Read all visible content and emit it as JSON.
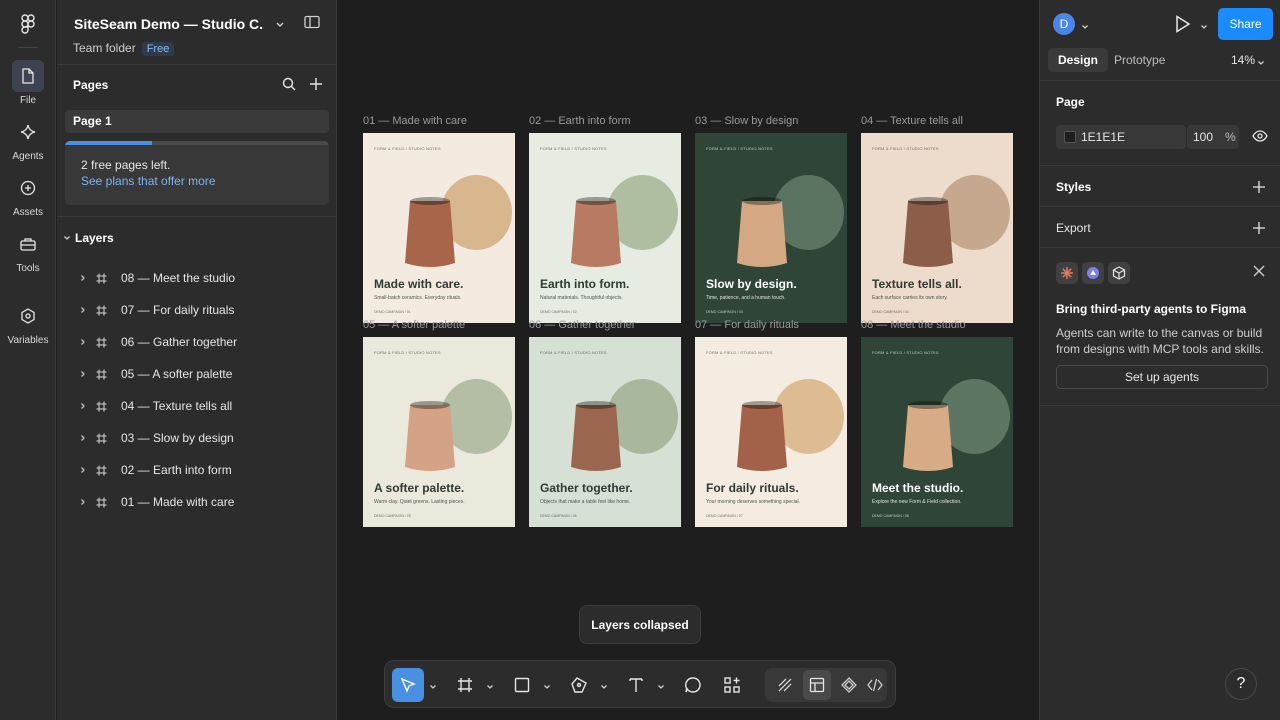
{
  "rail": {
    "items": [
      {
        "label": "File",
        "icon": "file-icon"
      },
      {
        "label": "Agents",
        "icon": "agents-icon"
      },
      {
        "label": "Assets",
        "icon": "assets-icon"
      },
      {
        "label": "Tools",
        "icon": "tools-icon"
      },
      {
        "label": "Variables",
        "icon": "variables-icon"
      }
    ]
  },
  "left_panel": {
    "file_title": "SiteSeam Demo — Studio C...",
    "folder": "Team folder",
    "plan_badge": "Free",
    "pages_title": "Pages",
    "current_page": "Page 1",
    "promo": {
      "text": "2 free pages left.",
      "link": "See plans that offer more",
      "progress": 0.33
    },
    "layers_title": "Layers",
    "layers": [
      "08 — Meet the studio",
      "07 — For daily rituals",
      "06 — Gather together",
      "05 — A softer palette",
      "04 — Texture tells all",
      "03 — Slow by design",
      "02 — Earth into form",
      "01 — Made with care"
    ]
  },
  "canvas": {
    "frames": [
      {
        "label": "01 — Made with care",
        "brand": "FORM & FIELD / STUDIO NOTES",
        "headline": "Made with care.",
        "sub": "Small-batch ceramics. Everyday rituals.",
        "foot": "DEMO CAMPAIGN / 01",
        "bg": "#f3ebdf",
        "circle": "#d8b78e",
        "pot": "#a8654a",
        "text": "#2e3a33"
      },
      {
        "label": "02 — Earth into form",
        "brand": "FORM & FIELD / STUDIO NOTES",
        "headline": "Earth into form.",
        "sub": "Natural materials. Thoughtful objects.",
        "foot": "DEMO CAMPAIGN / 02",
        "bg": "#e6ece2",
        "circle": "#afbea0",
        "pot": "#b87a62",
        "text": "#2e3a33"
      },
      {
        "label": "03 — Slow by design",
        "brand": "FORM & FIELD / STUDIO NOTES",
        "headline": "Slow by design.",
        "sub": "Time, patience, and a human touch.",
        "foot": "DEMO CAMPAIGN / 03",
        "bg": "#2e4538",
        "circle": "#5b7462",
        "pot": "#d3a883",
        "text": "#ffffff"
      },
      {
        "label": "04 — Texture tells all",
        "brand": "FORM & FIELD / STUDIO NOTES",
        "headline": "Texture tells all.",
        "sub": "Each surface carries its own story.",
        "foot": "DEMO CAMPAIGN / 04",
        "bg": "#eddccb",
        "circle": "#c6a88e",
        "pot": "#8c5e4a",
        "text": "#2e3a33"
      },
      {
        "label": "05 — A softer palette",
        "brand": "FORM & FIELD / STUDIO NOTES",
        "headline": "A softer palette.",
        "sub": "Warm clay. Quiet greens. Lasting pieces.",
        "foot": "DEMO CAMPAIGN / 05",
        "bg": "#ebe8dc",
        "circle": "#b4bea4",
        "pot": "#d4a286",
        "text": "#2e3a33"
      },
      {
        "label": "06 — Gather together",
        "brand": "FORM & FIELD / STUDIO NOTES",
        "headline": "Gather together.",
        "sub": "Objects that make a table feel like home.",
        "foot": "DEMO CAMPAIGN / 06",
        "bg": "#d7e0d5",
        "circle": "#a9b89c",
        "pot": "#9a6650",
        "text": "#2e3a33"
      },
      {
        "label": "07 — For daily rituals",
        "brand": "FORM & FIELD / STUDIO NOTES",
        "headline": "For daily rituals.",
        "sub": "Your morning deserves something special.",
        "foot": "DEMO CAMPAIGN / 07",
        "bg": "#f4ece0",
        "circle": "#ddbb93",
        "pot": "#a4614a",
        "text": "#2e3a33"
      },
      {
        "label": "08 — Meet the studio",
        "brand": "FORM & FIELD / STUDIO NOTES",
        "headline": "Meet the studio.",
        "sub": "Explore the new Form & Field collection.",
        "foot": "DEMO CAMPAIGN / 08",
        "bg": "#2f4538",
        "circle": "#5d7664",
        "pot": "#d6ab86",
        "text": "#ffffff"
      }
    ],
    "toast": "Layers collapsed"
  },
  "toolbar": {
    "tools": [
      "move-tool",
      "frame-tool",
      "rectangle-tool",
      "pen-tool",
      "text-tool",
      "comment-tool",
      "actions-tool"
    ],
    "modes": [
      "draw-mode",
      "design-mode",
      "components-mode",
      "dev-mode"
    ]
  },
  "right_panel": {
    "avatar": "D",
    "share": "Share",
    "tabs": {
      "design": "Design",
      "prototype": "Prototype"
    },
    "zoom": "14%",
    "page_section": "Page",
    "page_color": "1E1E1E",
    "page_color_hex": "#1E1E1E",
    "page_opacity": "100",
    "opacity_unit": "%",
    "styles": "Styles",
    "export": "Export",
    "agents_card": {
      "title": "Bring third-party agents to Figma",
      "body": "Agents can write to the canvas or build from designs with MCP tools and skills.",
      "button": "Set up agents"
    },
    "help": "?"
  }
}
